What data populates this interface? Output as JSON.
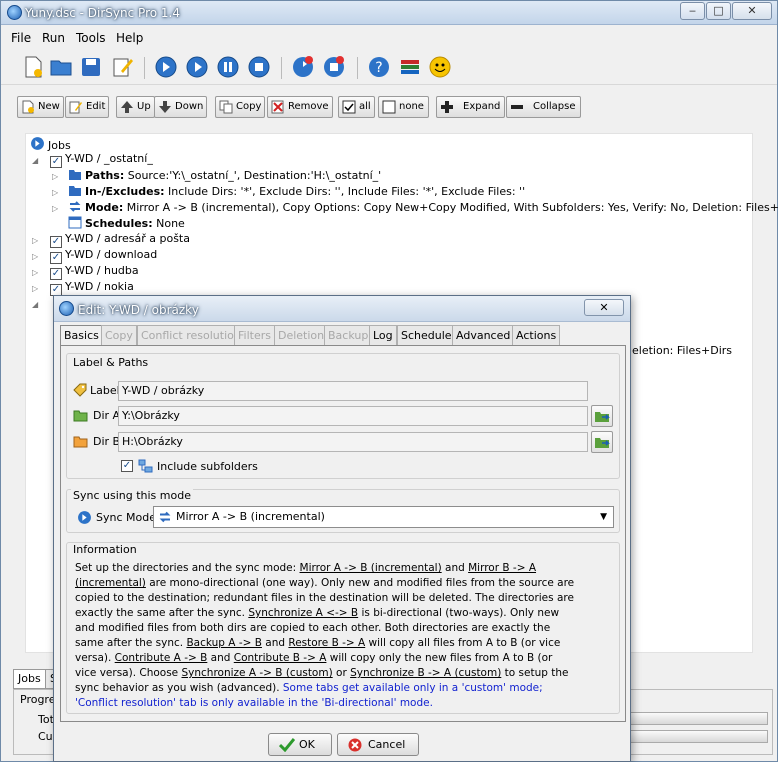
{
  "window": {
    "title": "Yuny.dsc - DirSync Pro 1.4",
    "min": "‒",
    "max": "□",
    "close": "✕"
  },
  "menu": [
    "File",
    "Run",
    "Tools",
    "Help"
  ],
  "toolbar_icons": [
    "new-file-icon",
    "open-folder-icon",
    "save-icon",
    "edit-icon",
    "play-icon",
    "play-all-icon",
    "pause-icon",
    "stop-icon",
    "sync-icon",
    "sync-stop-icon",
    "help-icon",
    "books-icon",
    "smiley-icon"
  ],
  "buttons": {
    "new": "New",
    "edit": "Edit",
    "up": "Up",
    "down": "Down",
    "copy": "Copy",
    "remove": "Remove",
    "all": "all",
    "none": "none",
    "expand": "Expand",
    "collapse": "Collapse"
  },
  "tree": {
    "root": "Jobs",
    "job1": "Y-WD / _ostatní_",
    "paths_label": "Paths:",
    "paths_value": " Source:'Y:\\_ostatní_', Destination:'H:\\_ostatní_'",
    "incl_label": "In-/Excludes:",
    "incl_value": " Include Dirs: '*', Exclude Dirs: '', Include Files: '*', Exclude Files: ''",
    "mode_label": "Mode:",
    "mode_value": " Mirror A -> B (incremental), Copy Options: Copy New+Copy Modified, With Subfolders: Yes, Verify: No, Deletion: Files+Dirs",
    "sched_label": "Schedules:",
    "sched_value": " None",
    "jobs": [
      "Y-WD / adresář a pošta",
      "Y-WD / download",
      "Y-WD / hudba",
      "Y-WD / nokia"
    ],
    "partial_right": "eletion: Files+Dirs"
  },
  "bottom": {
    "tab_jobs": "Jobs",
    "tab_s": "S",
    "progress": "Progres",
    "total": "Tot",
    "current": "Cur"
  },
  "dialog": {
    "title": "Edit: Y-WD / obrázky",
    "close": "✕",
    "tabs": [
      {
        "label": "Basics",
        "state": "active"
      },
      {
        "label": "Copy",
        "state": "disabled"
      },
      {
        "label": "Conflict resolution",
        "state": "disabled"
      },
      {
        "label": "Filters",
        "state": "disabled"
      },
      {
        "label": "Deletion",
        "state": "disabled"
      },
      {
        "label": "Backup",
        "state": "disabled"
      },
      {
        "label": "Log",
        "state": "normal"
      },
      {
        "label": "Schedule",
        "state": "normal"
      },
      {
        "label": "Advanced",
        "state": "normal"
      },
      {
        "label": "Actions",
        "state": "normal"
      }
    ],
    "label_paths": {
      "title": "Label & Paths",
      "label_caption": "Label",
      "label_value": "Y-WD / obrázky",
      "dir_a_caption": "Dir A",
      "dir_a_value": "Y:\\Obrázky",
      "dir_b_caption": "Dir B",
      "dir_b_value": "H:\\Obrázky",
      "include_sub": "Include subfolders"
    },
    "sync": {
      "title": "Sync using this mode",
      "caption": "Sync Mode:",
      "value": "Mirror A -> B (incremental)"
    },
    "info": {
      "title": "Information",
      "t1": "Set up the directories and the sync mode: ",
      "l1": "Mirror A -> B (incremental)",
      "t2": " and ",
      "l2": "Mirror B -> A (incremental)",
      "t3": " are mono-directional (one way). Only new and modified files from the source are copied to the destination; redundant files in the destination will be deleted. The directories are exactly the same after the sync. ",
      "l3": "Synchronize A <-> B",
      "t4": " is bi-directional (two-ways). Only new and modified files from both dirs are copied to each other. Both directories are exactly the same after the sync. ",
      "l4": "Backup A -> B",
      "t5": " and ",
      "l5": "Restore B -> A",
      "t6": " will copy all files from A to B (or vice versa). ",
      "l6": "Contribute A -> B",
      "t7": " and ",
      "l7": "Contribute B -> A",
      "t8": " will copy only the new files from A to B (or vice versa). Choose ",
      "l8": "Synchronize A -> B (custom)",
      "t9": " or ",
      "l9": "Synchronize B -> A (custom)",
      "t10": " to setup the sync behavior as you wish (advanced). ",
      "note": "Some tabs get available only in a 'custom' mode; 'Conflict resolution' tab is only available in the 'Bi-directional' mode."
    },
    "ok": "OK",
    "cancel": "Cancel"
  },
  "colors": {
    "link_blue": "#0f1fcf",
    "title_bar": "#c3d5ea",
    "accent": "#1b5fb3"
  }
}
